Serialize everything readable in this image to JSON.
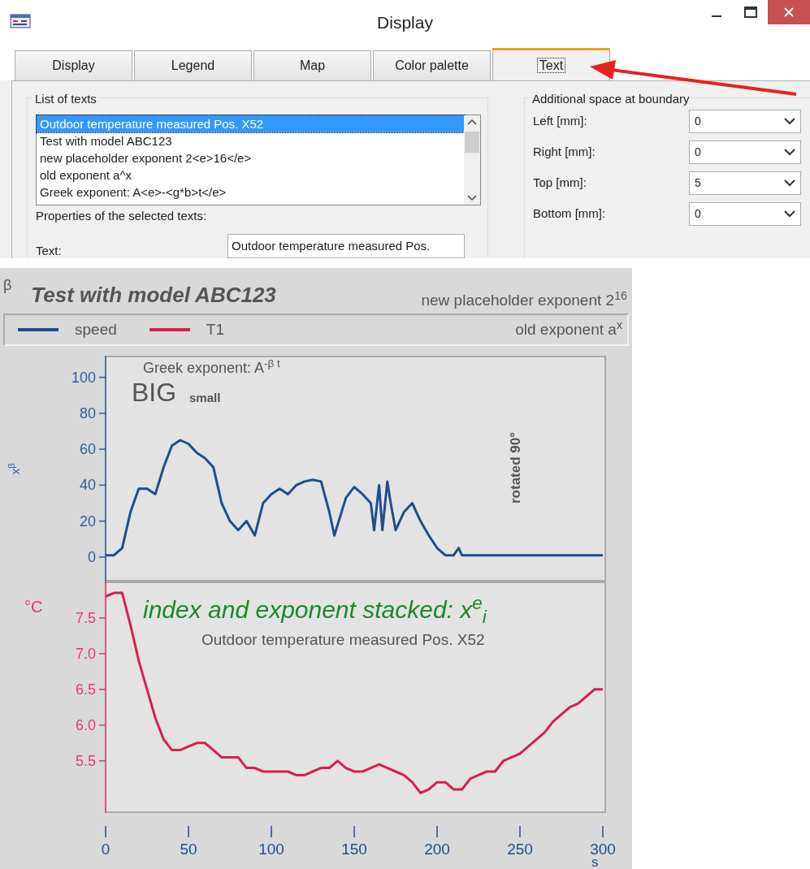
{
  "window": {
    "title": "Display"
  },
  "tabs": [
    {
      "label": "Display",
      "selected": false
    },
    {
      "label": "Legend",
      "selected": false
    },
    {
      "label": "Map",
      "selected": false
    },
    {
      "label": "Color palette",
      "selected": false
    },
    {
      "label": "Text",
      "selected": true
    }
  ],
  "list_of_texts": {
    "title": "List of texts",
    "items": [
      {
        "text": "Outdoor temperature measured Pos. X52",
        "selected": true
      },
      {
        "text": "Test with model ABC123",
        "selected": false
      },
      {
        "text": "new placeholder exponent 2<e>16</e>",
        "selected": false
      },
      {
        "text": "old exponent a^x",
        "selected": false
      },
      {
        "text": "Greek exponent: A<e>-<g*b>t</e>",
        "selected": false
      }
    ],
    "properties_label": "Properties of the selected texts:",
    "text_label": "Text:",
    "text_value": "Outdoor temperature measured Pos."
  },
  "boundary": {
    "title": "Additional space at boundary",
    "fields": [
      {
        "label": "Left [mm]:",
        "value": "0"
      },
      {
        "label": "Right [mm]:",
        "value": "0"
      },
      {
        "label": "Top [mm]:",
        "value": "5"
      },
      {
        "label": "Bottom [mm]:",
        "value": "0"
      }
    ]
  },
  "plot": {
    "corner_label": "β",
    "title": "Test with model ABC123",
    "subtitle": "new placeholder exponent 2$^{16}$",
    "legend_note": "old exponent a$^{x}$",
    "charts": [
      {
        "chart_data": {
          "type": "line",
          "ylabel": "x$^{β}$",
          "xlim": [
            0,
            300
          ],
          "ylim": [
            -13.6,
            112
          ],
          "yticks": [
            0,
            20,
            40,
            60,
            80,
            100
          ],
          "x": [
            0,
            5,
            10,
            15,
            20,
            25,
            30,
            35,
            40,
            45,
            50,
            55,
            60,
            65,
            70,
            75,
            80,
            85,
            90,
            95,
            100,
            105,
            110,
            115,
            120,
            125,
            130,
            135,
            138,
            140,
            145,
            150,
            155,
            160,
            162,
            165,
            167,
            170,
            172,
            175,
            180,
            185,
            190,
            195,
            200,
            205,
            210,
            213,
            215,
            220,
            260,
            300
          ],
          "series": [
            {
              "name": "speed",
              "color": "#1f4e8c",
              "values": [
                1,
                1,
                5,
                25,
                38,
                38,
                35,
                50,
                62,
                65,
                63,
                58,
                55,
                50,
                30,
                20,
                15,
                20,
                12,
                30,
                35,
                38,
                35,
                40,
                42,
                43,
                42,
                25,
                12,
                18,
                33,
                39,
                35,
                30,
                15,
                40,
                15,
                42,
                30,
                15,
                25,
                30,
                20,
                12,
                5,
                1,
                1,
                5,
                1,
                1,
                1,
                1
              ]
            }
          ]
        },
        "texts": [
          {
            "text": "Greek exponent: A$^{-β t}$",
            "kind": "note"
          },
          {
            "text": "BIG",
            "kind": "big"
          },
          {
            "text": "small",
            "kind": "small"
          },
          {
            "text": "rotated 90°",
            "kind": "rotated"
          }
        ]
      },
      {
        "chart_data": {
          "type": "line",
          "xlabel": "s",
          "ylabel": "°C",
          "xlim": [
            0,
            300
          ],
          "ylim": [
            4.77,
            8.01
          ],
          "xticks": [
            0,
            50,
            100,
            150,
            200,
            250,
            300
          ],
          "yticks": [
            {
              "value": 5.5,
              "label": "5.5"
            },
            {
              "value": 6,
              "label": "6.0"
            },
            {
              "value": 6.5,
              "label": "6.5"
            },
            {
              "value": 7,
              "label": "7.0"
            },
            {
              "value": 7.5,
              "label": "7.5"
            }
          ],
          "x": [
            0,
            5,
            10,
            15,
            20,
            25,
            30,
            35,
            40,
            45,
            50,
            55,
            60,
            65,
            70,
            75,
            80,
            85,
            90,
            95,
            100,
            105,
            110,
            115,
            120,
            125,
            130,
            135,
            140,
            145,
            150,
            155,
            160,
            165,
            170,
            175,
            180,
            185,
            190,
            195,
            200,
            205,
            210,
            215,
            220,
            225,
            230,
            235,
            240,
            245,
            250,
            255,
            260,
            265,
            270,
            275,
            280,
            285,
            290,
            295,
            300
          ],
          "series": [
            {
              "name": "T1",
              "color": "#d81f4f",
              "values": [
                7.8,
                7.85,
                7.85,
                7.4,
                6.9,
                6.5,
                6.1,
                5.8,
                5.65,
                5.65,
                5.7,
                5.75,
                5.75,
                5.65,
                5.55,
                5.55,
                5.55,
                5.4,
                5.4,
                5.35,
                5.35,
                5.35,
                5.35,
                5.3,
                5.3,
                5.35,
                5.4,
                5.4,
                5.5,
                5.4,
                5.35,
                5.35,
                5.4,
                5.45,
                5.4,
                5.35,
                5.3,
                5.2,
                5.05,
                5.1,
                5.2,
                5.2,
                5.1,
                5.1,
                5.25,
                5.3,
                5.35,
                5.35,
                5.5,
                5.55,
                5.6,
                5.7,
                5.8,
                5.9,
                6.05,
                6.15,
                6.25,
                6.3,
                6.4,
                6.5,
                6.5
              ]
            }
          ]
        },
        "texts": [
          {
            "text": "index and exponent stacked: x$^{e}$$_{i}$",
            "kind": "highlight"
          },
          {
            "text": "Outdoor temperature measured Pos. X52",
            "kind": "caption"
          }
        ]
      }
    ]
  }
}
